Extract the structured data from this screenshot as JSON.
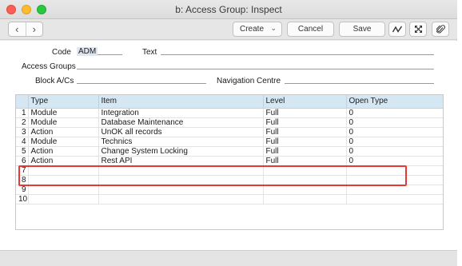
{
  "window": {
    "title": "b: Access Group: Inspect"
  },
  "toolbar": {
    "create_label": "Create",
    "cancel_label": "Cancel",
    "save_label": "Save"
  },
  "form": {
    "code_label": "Code",
    "code_value": "ADM",
    "text_label": "Text",
    "text_value": "",
    "access_groups_label": "Access Groups",
    "access_groups_value": "",
    "block_label": "Block A/Cs",
    "block_value": "",
    "nav_label": "Navigation Centre",
    "nav_value": ""
  },
  "grid": {
    "headers": [
      "",
      "Type",
      "Item",
      "Level",
      "Open Type"
    ],
    "rows": [
      {
        "n": "1",
        "type": "Module",
        "item": "Integration",
        "level": "Full",
        "open": "0"
      },
      {
        "n": "2",
        "type": "Module",
        "item": "Database Maintenance",
        "level": "Full",
        "open": "0"
      },
      {
        "n": "3",
        "type": "Action",
        "item": "UnOK all records",
        "level": "Full",
        "open": "0"
      },
      {
        "n": "4",
        "type": "Module",
        "item": "Technics",
        "level": "Full",
        "open": "0"
      },
      {
        "n": "5",
        "type": "Action",
        "item": "Change System Locking",
        "level": "Full",
        "open": "0"
      },
      {
        "n": "6",
        "type": "Action",
        "item": "Rest API",
        "level": "Full",
        "open": "0"
      },
      {
        "n": "7",
        "type": "",
        "item": "",
        "level": "",
        "open": ""
      },
      {
        "n": "8",
        "type": "",
        "item": "",
        "level": "",
        "open": ""
      },
      {
        "n": "9",
        "type": "",
        "item": "",
        "level": "",
        "open": ""
      },
      {
        "n": "10",
        "type": "",
        "item": "",
        "level": "",
        "open": ""
      }
    ]
  },
  "colors": {
    "header_bg": "#d5e7f2",
    "highlight": "#e53935"
  }
}
